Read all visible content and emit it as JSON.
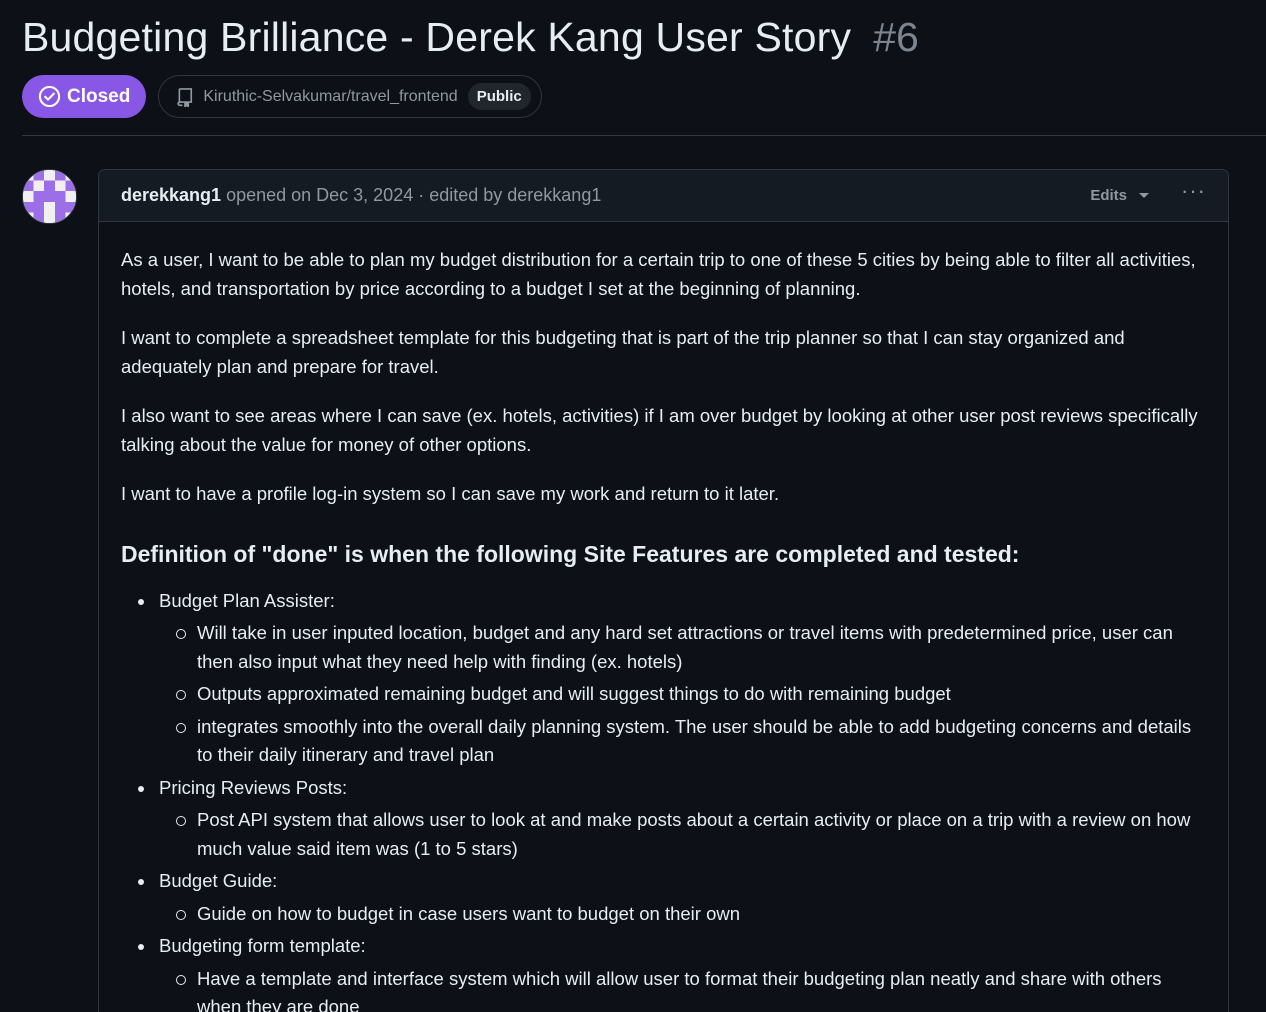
{
  "issue": {
    "title": "Budgeting Brilliance - Derek Kang User Story",
    "number": "#6",
    "state": "Closed",
    "state_color": "#8957e5",
    "repo": "Kiruthic-Selvakumar/travel_frontend",
    "visibility": "Public"
  },
  "comment": {
    "author": "derekkang1",
    "meta": "opened on Dec 3, 2024 · edited by derekkang1",
    "edits_label": "Edits",
    "more_label": "···",
    "paragraphs": [
      "As a user, I want to be able to plan my budget distribution for a certain trip to one of these 5 cities by being able to filter all activities, hotels, and transportation by price according to a budget I set at the beginning of planning.",
      "I want to complete a spreadsheet template for this budgeting that is part of the trip planner so that I can stay organized and adequately plan and prepare for travel.",
      "I also want to see areas where I can save (ex. hotels, activities) if I am over budget by looking at other user post reviews specifically talking about the value for money of other options.",
      "I want to have a profile log-in system so I can save my work and return to it later."
    ],
    "heading": "Definition of \"done\" is when the following Site Features are completed and tested:",
    "features": [
      {
        "label": "Budget Plan Assister:",
        "items": [
          "Will take in user inputed location, budget and any hard set attractions or travel items with predetermined price, user can then also input what they need help with finding (ex. hotels)",
          "Outputs approximated remaining budget and will suggest things to do with remaining budget",
          "integrates smoothly into the overall daily planning system. The user should be able to add budgeting concerns and details to their daily itinerary and travel plan"
        ]
      },
      {
        "label": "Pricing Reviews Posts:",
        "items": [
          "Post API system that allows user to look at and make posts about a certain activity or place on a trip with a review on how much value said item was (1 to 5 stars)"
        ]
      },
      {
        "label": "Budget Guide:",
        "items": [
          "Guide on how to budget in case users want to budget on their own"
        ]
      },
      {
        "label": "Budgeting form template:",
        "items": [
          "Have a template and interface system which will allow user to format their budgeting plan neatly and share with others when they are done"
        ]
      }
    ]
  }
}
